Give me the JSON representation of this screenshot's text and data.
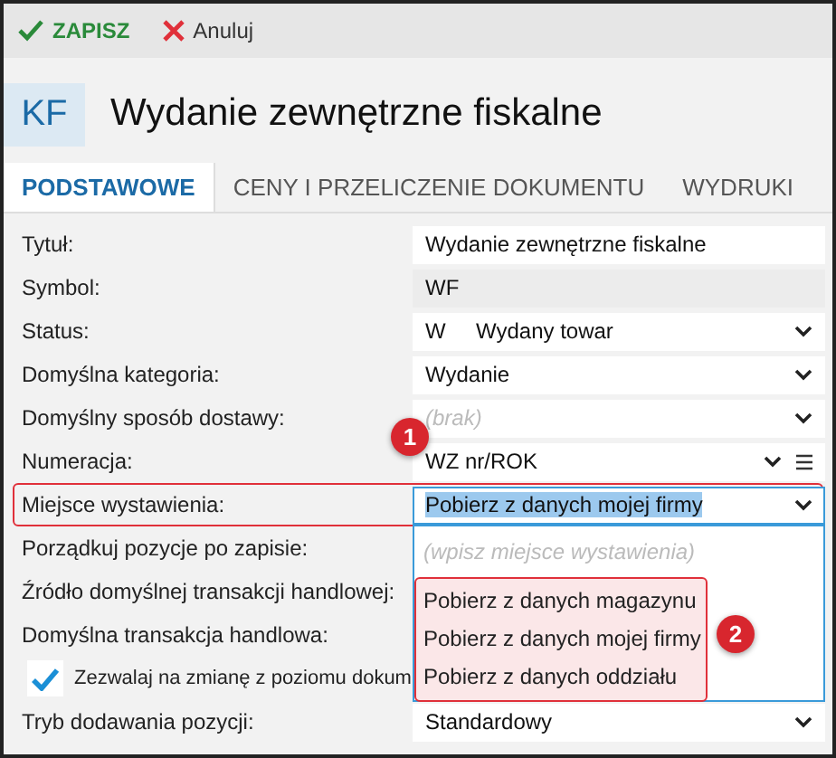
{
  "toolbar": [
    {
      "kind": "save",
      "label": "ZAPISZ"
    },
    {
      "kind": "cancel",
      "label": "Anuluj"
    }
  ],
  "header": {
    "badge": "KF",
    "title": "Wydanie zewnętrzne fiskalne"
  },
  "tabs": [
    {
      "label": "PODSTAWOWE",
      "selected": true
    },
    {
      "label": "CENY I PRZELICZENIE DOKUMENTU",
      "selected": false
    },
    {
      "label": "WYDRUKI",
      "selected": false
    }
  ],
  "fields": [
    {
      "kind": "text",
      "label": "Tytuł:",
      "value": "Wydanie zewnętrzne fiskalne"
    },
    {
      "kind": "readonly",
      "label": "Symbol:",
      "value": "WF"
    },
    {
      "kind": "select",
      "label": "Status:",
      "code": "W",
      "value": "Wydany towar"
    },
    {
      "kind": "select",
      "label": "Domyślna kategoria:",
      "value": "Wydanie"
    },
    {
      "kind": "select",
      "label": "Domyślny sposób dostawy:",
      "placeholder": "(brak)"
    },
    {
      "kind": "numbering",
      "label": "Numeracja:",
      "value": "WZ nr/ROK",
      "callout": "1"
    },
    {
      "kind": "combo",
      "label": "Miejsce wystawienia:",
      "value": "Pobierz z danych mojej firmy",
      "highlighted": true,
      "focused": true,
      "dropdown": {
        "placeholder": "(wpisz miejsce wystawienia)",
        "options": [
          "Pobierz z danych magazynu",
          "Pobierz z danych mojej firmy",
          "Pobierz z danych oddziału"
        ],
        "callout": "2"
      }
    },
    {
      "kind": "hidden",
      "label": "Porządkuj pozycje po zapisie:"
    },
    {
      "kind": "hidden",
      "label": "Źródło domyślnej transakcji handlowej:"
    },
    {
      "kind": "hidden",
      "label": "Domyślna transakcja handlowa:"
    },
    {
      "kind": "checkbox",
      "label": "Zezwalaj na zmianę z poziomu dokum",
      "checked": true
    },
    {
      "kind": "select",
      "label": "Tryb dodawania pozycji:",
      "value": "Standardowy"
    }
  ]
}
